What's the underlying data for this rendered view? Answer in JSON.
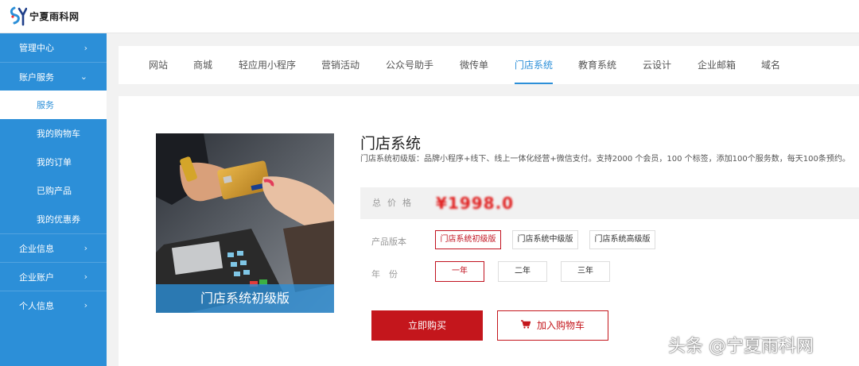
{
  "logo": {
    "text": "宁夏雨科网",
    "icon": "ys-logo-icon"
  },
  "sidebar": {
    "items": [
      {
        "label": "管理中心",
        "chevron": "›"
      },
      {
        "label": "账户服务",
        "chevron": "⌄"
      },
      {
        "label": "服务",
        "sub": true,
        "active": true
      },
      {
        "label": "我的购物车",
        "sub": true
      },
      {
        "label": "我的订单",
        "sub": true
      },
      {
        "label": "已购产品",
        "sub": true
      },
      {
        "label": "我的优惠券",
        "sub": true
      },
      {
        "label": "企业信息",
        "chevron": "›"
      },
      {
        "label": "企业账户",
        "chevron": "›"
      },
      {
        "label": "个人信息",
        "chevron": "›"
      }
    ]
  },
  "tabs": [
    "网站",
    "商城",
    "轻应用小程序",
    "营销活动",
    "公众号助手",
    "微传单",
    "门店系统",
    "教育系统",
    "云设计",
    "企业邮箱",
    "域名"
  ],
  "active_tab": "门店系统",
  "product": {
    "image_caption": "门店系统初级版",
    "title": "门店系统",
    "description": "门店系统初级版：品牌小程序+线下、线上一体化经营+微信支付。支持2000 个会员，100 个标签，添加100个服务数，每天100条预约。",
    "price_label": "总价格",
    "price_value": "¥1998.0",
    "version_label": "产品版本",
    "versions": [
      "门店系统初级版",
      "门店系统中级版",
      "门店系统高级版"
    ],
    "selected_version": "门店系统初级版",
    "year_label": "年　份",
    "years": [
      "一年",
      "二年",
      "三年"
    ],
    "selected_year": "一年"
  },
  "actions": {
    "buy_label": "立即购买",
    "cart_label": "加入购物车"
  },
  "watermark": "头条 @宁夏雨科网",
  "colors": {
    "brand_blue": "#2c8fd8",
    "accent_red": "#c4161c"
  }
}
